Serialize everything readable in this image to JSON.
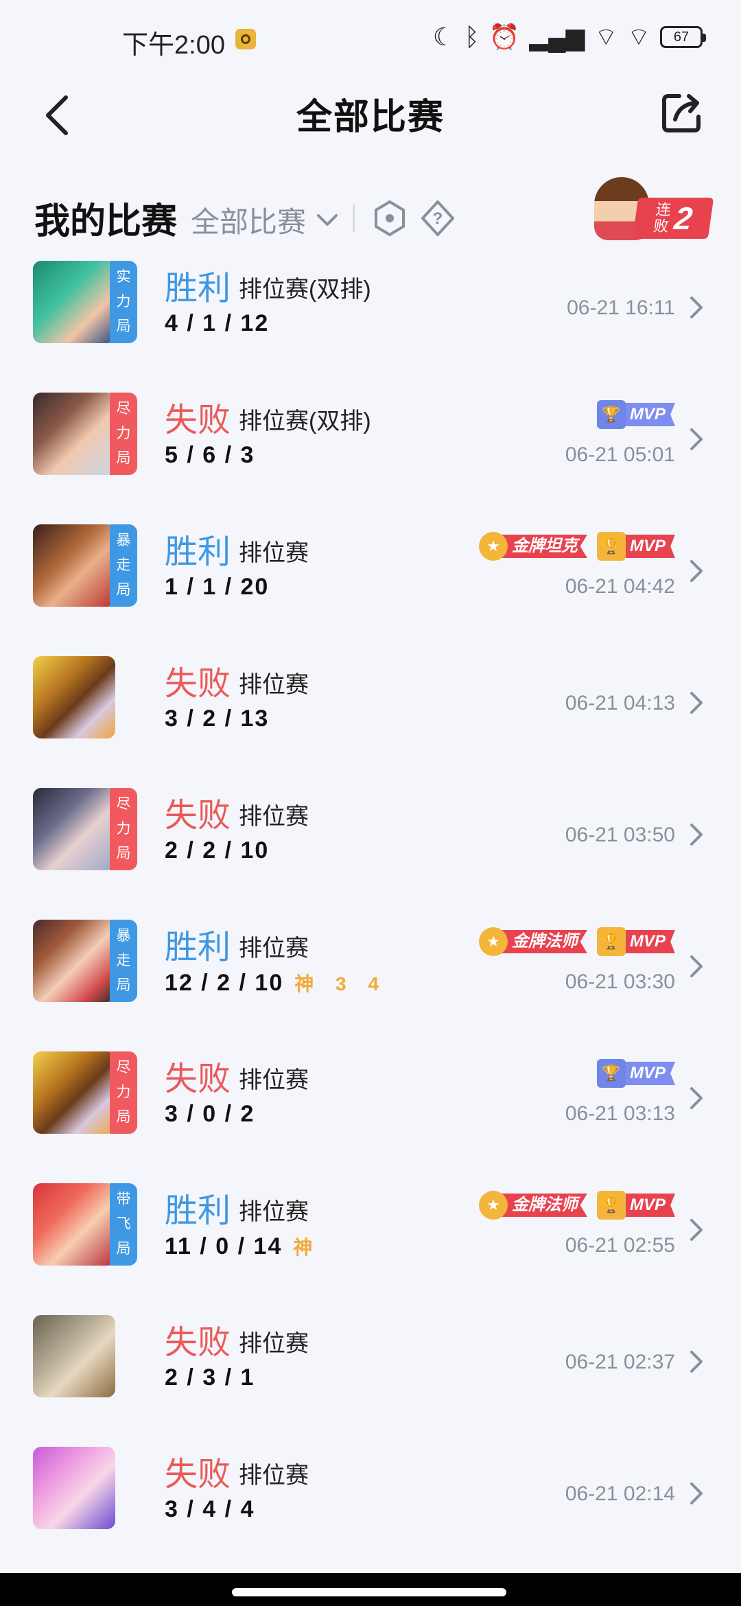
{
  "status_bar": {
    "time": "下午2:00",
    "battery": "67"
  },
  "nav": {
    "title": "全部比赛"
  },
  "section": {
    "title": "我的比赛",
    "filter_label": "全部比赛",
    "streak_label": "连败",
    "streak_count": "2"
  },
  "matches": [
    {
      "result": "胜利",
      "type": "排位赛(双排)",
      "kda": "4 / 1 / 12",
      "god": "",
      "date": "06-21 16:11",
      "tag": "实力局",
      "badges": []
    },
    {
      "result": "失败",
      "type": "排位赛(双排)",
      "kda": "5 / 6 / 3",
      "god": "",
      "date": "06-21 05:01",
      "tag": "尽力局",
      "badges": [
        "MVP"
      ]
    },
    {
      "result": "胜利",
      "type": "排位赛",
      "kda": "1 / 1 / 20",
      "god": "",
      "date": "06-21 04:42",
      "tag": "暴走局",
      "badges": [
        "金牌坦克",
        "MVP"
      ]
    },
    {
      "result": "失败",
      "type": "排位赛",
      "kda": "3 / 2 / 13",
      "god": "",
      "date": "06-21 04:13",
      "tag": "",
      "badges": []
    },
    {
      "result": "失败",
      "type": "排位赛",
      "kda": "2 / 2 / 10",
      "god": "",
      "date": "06-21 03:50",
      "tag": "尽力局",
      "badges": []
    },
    {
      "result": "胜利",
      "type": "排位赛",
      "kda": "12 / 2 / 10",
      "god": "神 3 4",
      "date": "06-21 03:30",
      "tag": "暴走局",
      "badges": [
        "金牌法师",
        "MVP"
      ]
    },
    {
      "result": "失败",
      "type": "排位赛",
      "kda": "3 / 0 / 2",
      "god": "",
      "date": "06-21 03:13",
      "tag": "尽力局",
      "badges": [
        "MVP"
      ]
    },
    {
      "result": "胜利",
      "type": "排位赛",
      "kda": "11 / 0 / 14",
      "god": "神",
      "date": "06-21 02:55",
      "tag": "带飞局",
      "badges": [
        "金牌法师",
        "MVP"
      ]
    },
    {
      "result": "失败",
      "type": "排位赛",
      "kda": "2 / 3 / 1",
      "god": "",
      "date": "06-21 02:37",
      "tag": "",
      "badges": []
    },
    {
      "result": "失败",
      "type": "排位赛",
      "kda": "3 / 4 / 4",
      "god": "",
      "date": "06-21 02:14",
      "tag": "",
      "badges": []
    }
  ],
  "tag_chars": {
    "m0": [
      "实",
      "力",
      "局"
    ],
    "m1": [
      "尽",
      "力",
      "局"
    ],
    "m2": [
      "暴",
      "走",
      "局"
    ],
    "m4": [
      "尽",
      "力",
      "局"
    ],
    "m5": [
      "暴",
      "走",
      "局"
    ],
    "m6": [
      "尽",
      "力",
      "局"
    ],
    "m7": [
      "带",
      "飞",
      "局"
    ]
  },
  "colors": {
    "win": "#3e98e3",
    "loss": "#ea5a5a",
    "gold": "#f3b53a",
    "badge_red": "#e8424f",
    "mvp_blue": "#7d8ef0"
  },
  "icons": [
    "back-arrow-icon",
    "share-icon",
    "chevron-down-icon",
    "hexagon-settings-icon",
    "help-diamond-icon",
    "chevron-right-icon",
    "moon-icon",
    "bluetooth-icon",
    "alarm-icon",
    "signal-icon",
    "wifi-icon",
    "battery-icon"
  ]
}
